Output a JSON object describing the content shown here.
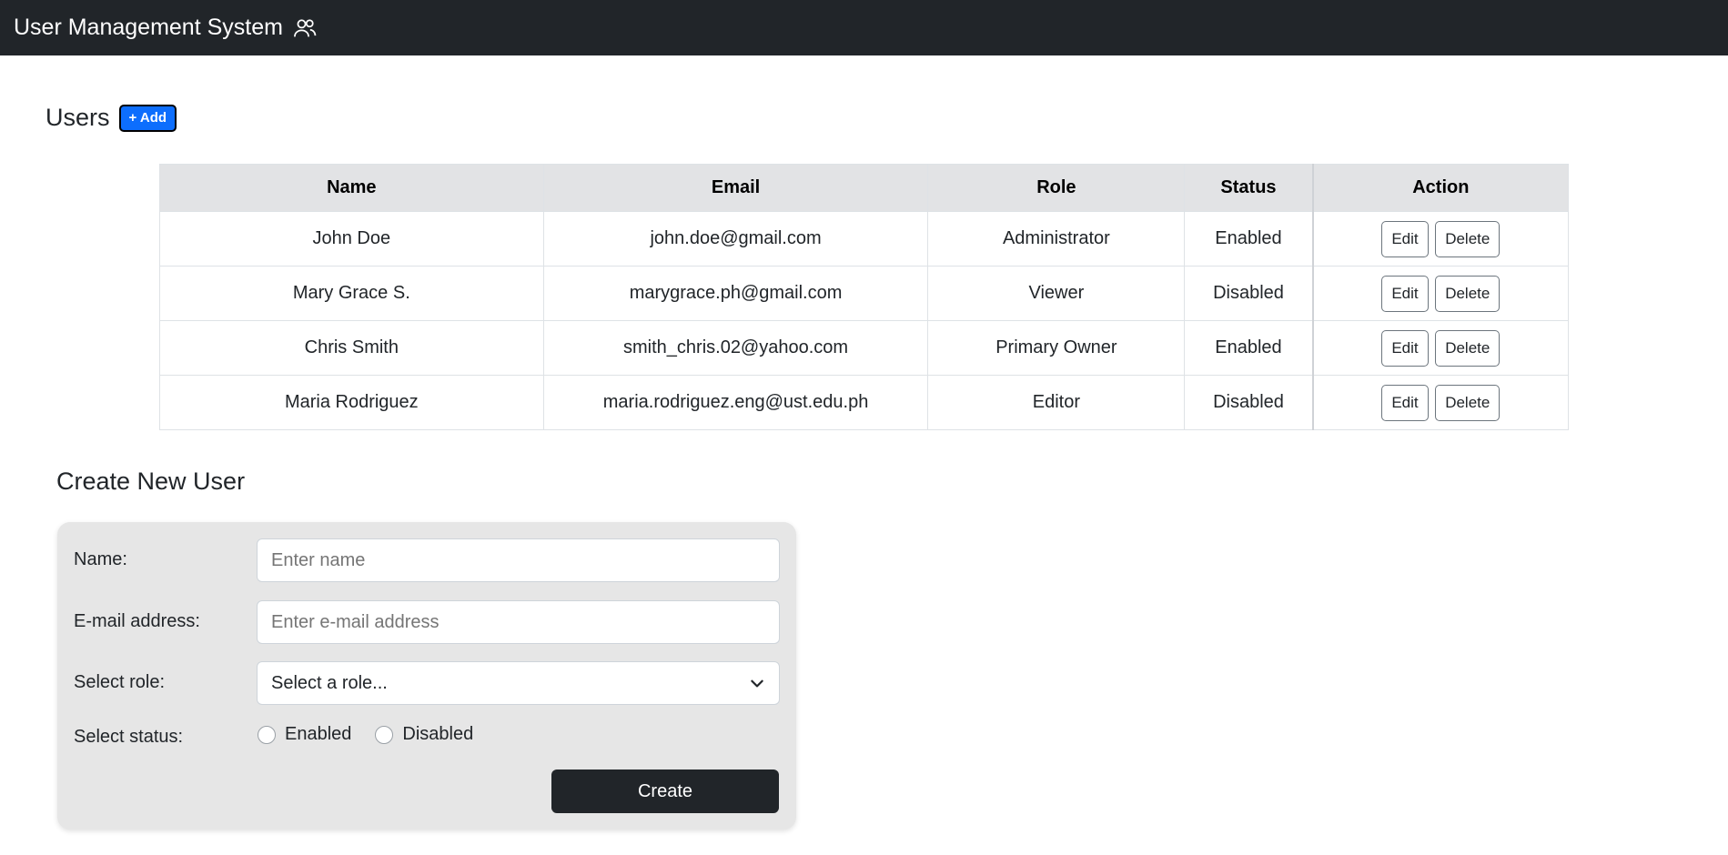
{
  "navbar": {
    "title": "User Management System",
    "icon": "users-icon"
  },
  "users_section": {
    "heading": "Users",
    "add_label": "+ Add",
    "add_color": "#0d6efd"
  },
  "table": {
    "headers": {
      "name": "Name",
      "email": "Email",
      "role": "Role",
      "status": "Status",
      "action": "Action"
    },
    "rows": [
      {
        "name": "John Doe",
        "email": "john.doe@gmail.com",
        "role": "Administrator",
        "status": "Enabled"
      },
      {
        "name": "Mary Grace S.",
        "email": "marygrace.ph@gmail.com",
        "role": "Viewer",
        "status": "Disabled"
      },
      {
        "name": "Chris Smith",
        "email": "smith_chris.02@yahoo.com",
        "role": "Primary Owner",
        "status": "Enabled"
      },
      {
        "name": "Maria Rodriguez",
        "email": "maria.rodriguez.eng@ust.edu.ph",
        "role": "Editor",
        "status": "Disabled"
      }
    ],
    "edit_label": "Edit",
    "delete_label": "Delete"
  },
  "create_form": {
    "heading": "Create New User",
    "name_label": "Name:",
    "name_placeholder": "Enter name",
    "email_label": "E-mail address:",
    "email_placeholder": "Enter e-mail address",
    "role_label": "Select role:",
    "role_selected": "Select a role...",
    "status_label": "Select status:",
    "status_options": [
      "Enabled",
      "Disabled"
    ],
    "submit_label": "Create"
  },
  "colors": {
    "navbar_bg": "#212529",
    "primary": "#0d6efd",
    "card_bg": "#e6e6e6"
  }
}
